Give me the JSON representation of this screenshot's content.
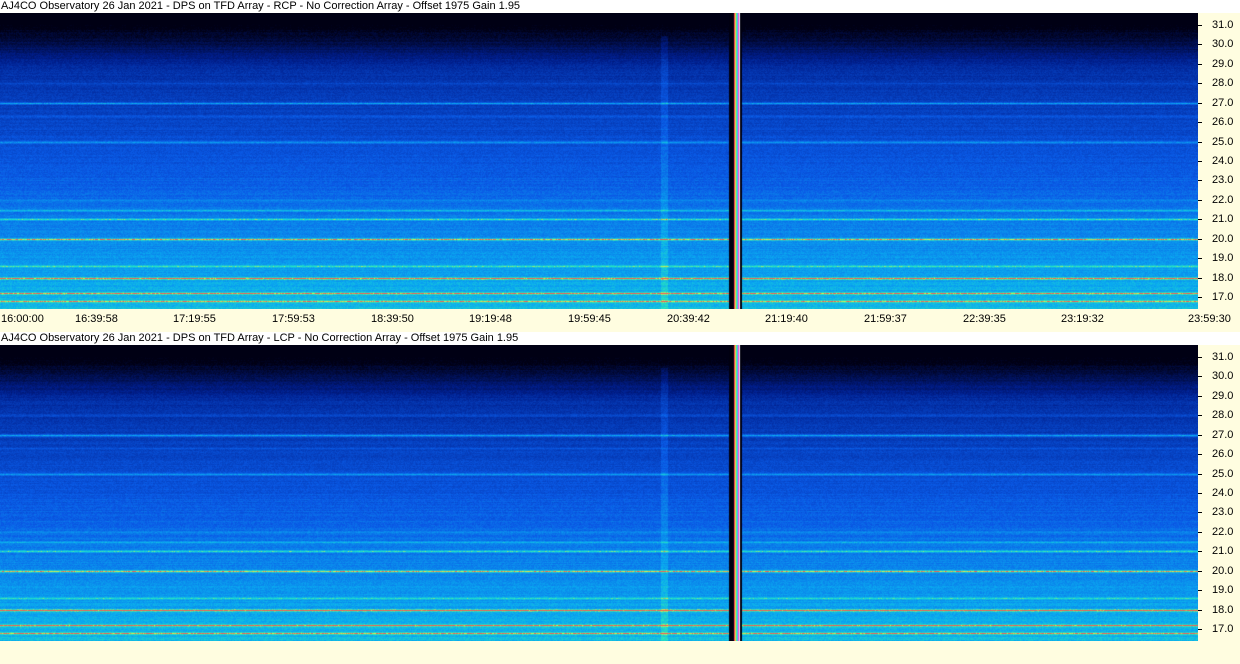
{
  "panels": [
    {
      "title": "AJ4CO Observatory 26 Jan 2021 - DPS on TFD Array  - RCP  -  No Correction Array  -  Offset 1975  Gain 1.95",
      "polarization": "RCP"
    },
    {
      "title": "AJ4CO Observatory 26 Jan 2021 - DPS on TFD Array  - LCP  -  No Correction Array  -  Offset 1975  Gain 1.95",
      "polarization": "LCP"
    }
  ],
  "frequency_axis_labels": [
    "31.0",
    "30.0",
    "29.0",
    "28.0",
    "27.0",
    "26.0",
    "25.0",
    "24.0",
    "23.0",
    "22.0",
    "21.0",
    "20.0",
    "19.0",
    "18.0",
    "17.0"
  ],
  "time_axis_labels": [
    "16:00:00",
    "16:39:58",
    "17:19:55",
    "17:59:53",
    "18:39:50",
    "19:19:48",
    "19:59:45",
    "20:39:42",
    "21:19:40",
    "21:59:37",
    "22:39:35",
    "23:19:32",
    "23:59:30"
  ],
  "colors": {
    "background": "#fffde0",
    "spectrum_low": "#000018",
    "spectrum_mid": "#0a5ae6",
    "spectrum_high": "#2ef0c0",
    "rfi_line": "#f0e040",
    "calibration_bar": "#ff4060"
  }
}
